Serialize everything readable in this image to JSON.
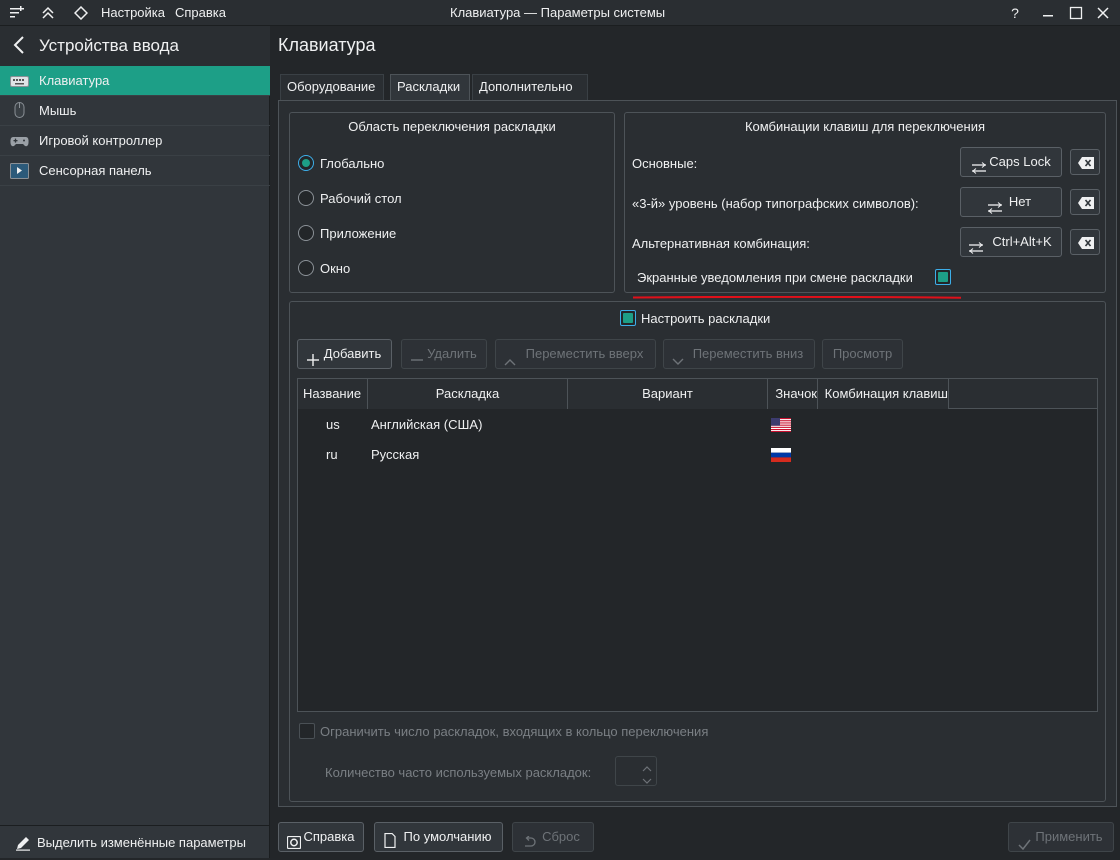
{
  "window": {
    "menu_settings": "Настройка",
    "menu_help": "Справка",
    "title": "Клавиатура — Параметры системы",
    "help_icon": "?",
    "minimize_icon": "minimize-icon",
    "maximize_icon": "maximize-icon",
    "close_icon": "close-icon"
  },
  "sidebar": {
    "header": "Устройства ввода",
    "items": [
      {
        "label": "Клавиатура",
        "icon": "keyboard-icon",
        "selected": true
      },
      {
        "label": "Мышь",
        "icon": "mouse-icon",
        "selected": false
      },
      {
        "label": "Игровой контроллер",
        "icon": "gamepad-icon",
        "selected": false
      },
      {
        "label": "Сенсорная панель",
        "icon": "touchpad-icon",
        "selected": false
      }
    ],
    "footer": "Выделить изменённые параметры"
  },
  "page": {
    "title": "Клавиатура",
    "tabs": [
      "Оборудование",
      "Раскладки",
      "Дополнительно"
    ],
    "active_tab": "Раскладки"
  },
  "switch_area": {
    "title": "Область переключения раскладки",
    "options": [
      "Глобально",
      "Рабочий стол",
      "Приложение",
      "Окно"
    ],
    "selected": "Глобально"
  },
  "shortcuts": {
    "title": "Комбинации клавиш для переключения",
    "rows": [
      {
        "label": "Основные:",
        "value": "Caps Lock"
      },
      {
        "label": "«3-й» уровень (набор типографских символов):",
        "value": "Нет"
      },
      {
        "label": "Альтернативная комбинация:",
        "value": "Ctrl+Alt+K"
      }
    ],
    "osd_label": "Экранные уведомления при смене раскладки",
    "osd_checked": true
  },
  "layouts": {
    "configure_label": "Настроить раскладки",
    "configure_checked": true,
    "buttons": {
      "add": "Добавить",
      "remove": "Удалить",
      "move_up": "Переместить вверх",
      "move_down": "Переместить вниз",
      "preview": "Просмотр"
    },
    "columns": [
      "Название",
      "Раскладка",
      "Вариант",
      "Значок",
      "Комбинация клавиш"
    ],
    "rows": [
      {
        "name": "us",
        "layout": "Английская (США)",
        "variant": "",
        "flag": "us-flag-icon",
        "shortcut": ""
      },
      {
        "name": "ru",
        "layout": "Русская",
        "variant": "",
        "flag": "ru-flag-icon",
        "shortcut": ""
      }
    ],
    "limit_label": "Ограничить число раскладок, входящих в кольцо переключения",
    "count_label": "Количество часто используемых раскладок:"
  },
  "footer_buttons": {
    "help": "Справка",
    "defaults": "По умолчанию",
    "reset": "Сброс",
    "apply": "Применить"
  },
  "colors": {
    "accent": "#1d9f87",
    "highlight": "#3daee9",
    "underline": "#e0101a"
  }
}
